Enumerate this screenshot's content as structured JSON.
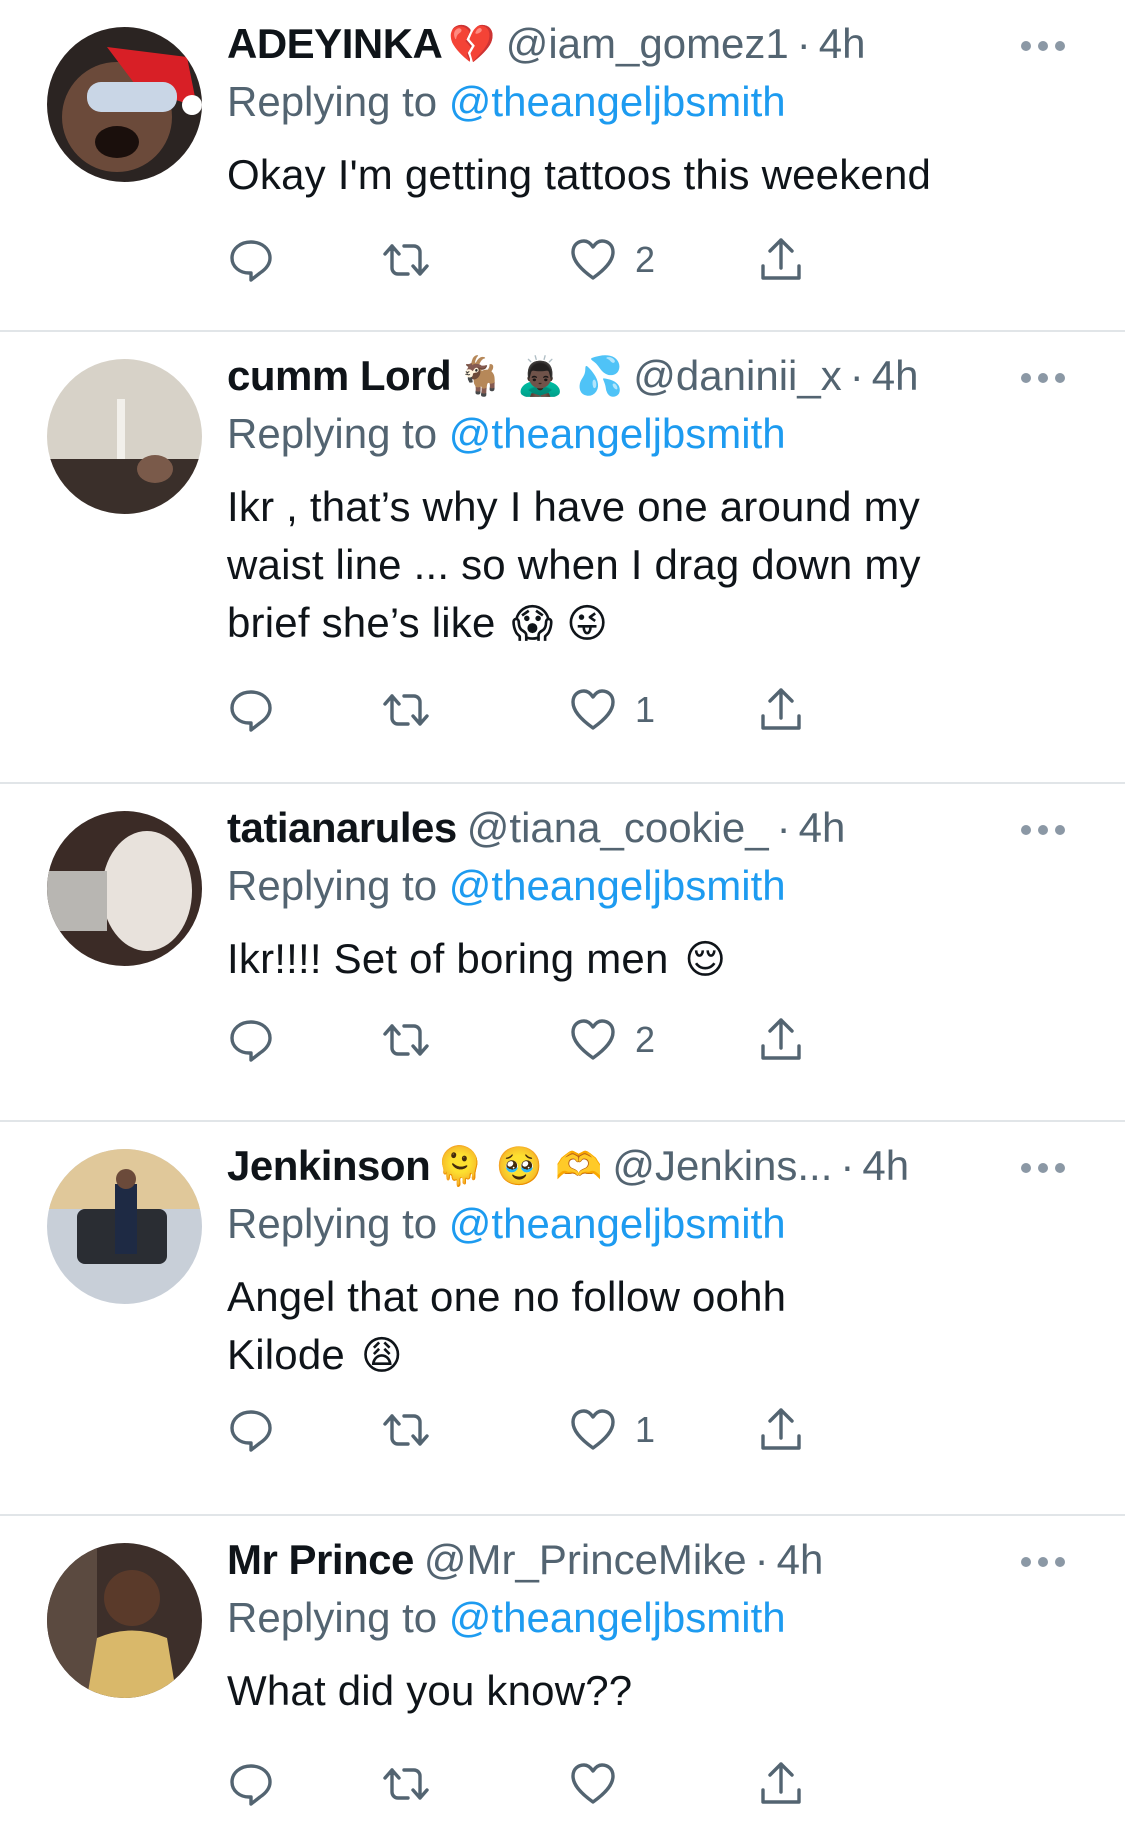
{
  "colors": {
    "accent": "#1d9bf0",
    "secondary_text": "#536471",
    "divider": "#e1e5e8"
  },
  "tweets": [
    {
      "name": "ADEYINKA",
      "name_emojis": "💔",
      "handle": "@iam_gomez1",
      "separator": "·",
      "time": "4h",
      "replying_prefix": "Replying to",
      "replying_to": "@theangeljbsmith",
      "text": "Okay I'm getting tattoos this weekend",
      "text_emojis": "",
      "likes": "2"
    },
    {
      "name": "cumm Lord",
      "name_emojis": "🐐 🙇🏿‍♂️ 💦",
      "handle": "@daninii_x",
      "separator": "·",
      "time": "4h",
      "replying_prefix": "Replying to",
      "replying_to": "@theangeljbsmith",
      "text": "Ikr , that’s why I have one around my waist line ... so when I drag down my brief she’s like",
      "text_emojis": "😱 😜",
      "likes": "1"
    },
    {
      "name": "tatianarules",
      "name_emojis": "",
      "handle": "@tiana_cookie_",
      "separator": "·",
      "time": "4h",
      "replying_prefix": "Replying to",
      "replying_to": "@theangeljbsmith",
      "text": "Ikr!!!! Set of boring men",
      "text_emojis": "😌",
      "likes": "2"
    },
    {
      "name": "Jenkinson",
      "name_emojis": "🫠 🥹 🫶",
      "handle": "@Jenkins...",
      "separator": "·",
      "time": "4h",
      "replying_prefix": "Replying to",
      "replying_to": "@theangeljbsmith",
      "text": "Angel that one no follow oohh Kilode",
      "text_emojis": "😩",
      "likes": "1"
    },
    {
      "name": "Mr Prince",
      "name_emojis": "",
      "handle": "@Mr_PrinceMike",
      "separator": "·",
      "time": "4h",
      "replying_prefix": "Replying to",
      "replying_to": "@theangeljbsmith",
      "text": "What did you know??",
      "text_emojis": "",
      "likes": ""
    }
  ],
  "icons": {
    "more": "more-options-icon",
    "reply": "reply-icon",
    "retweet": "retweet-icon",
    "like": "heart-icon",
    "share": "share-icon"
  }
}
